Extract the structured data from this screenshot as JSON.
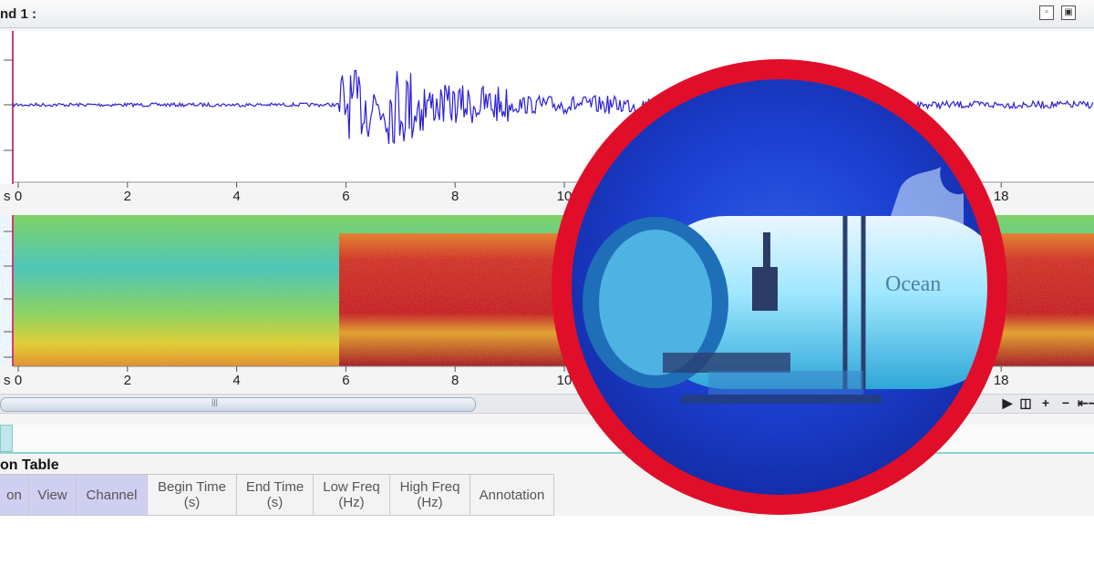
{
  "window": {
    "title": "nd 1 :",
    "restore_icon": "restore-icon",
    "maximize_icon": "maximize-icon"
  },
  "waveform": {
    "tick_labels": [
      "0",
      "2",
      "4",
      "6",
      "8",
      "10",
      "18"
    ],
    "axis_unit": "s",
    "trace_color": "#2b1fd6"
  },
  "spectrogram": {
    "tick_labels": [
      "0",
      "2",
      "4",
      "6",
      "8",
      "10",
      "18"
    ],
    "axis_unit": "s"
  },
  "controls": [
    {
      "name": "play-icon",
      "glyph": "▶"
    },
    {
      "name": "view-toggle-icon",
      "glyph": "◫"
    },
    {
      "name": "zoom-in-icon",
      "glyph": "+"
    },
    {
      "name": "zoom-out-icon",
      "glyph": "−"
    },
    {
      "name": "fit-icon",
      "glyph": "⇤⇥"
    }
  ],
  "table": {
    "title": "on Table",
    "columns": [
      {
        "line1": "on",
        "line2": "",
        "selected": true
      },
      {
        "line1": "View",
        "line2": "",
        "selected": true
      },
      {
        "line1": "Channel",
        "line2": "",
        "selected": true
      },
      {
        "line1": "Begin Time",
        "line2": "(s)",
        "selected": false
      },
      {
        "line1": "End Time",
        "line2": "(s)",
        "selected": false
      },
      {
        "line1": "Low Freq",
        "line2": "(Hz)",
        "selected": false
      },
      {
        "line1": "High Freq",
        "line2": "(Hz)",
        "selected": false
      },
      {
        "line1": "Annotation",
        "line2": "",
        "selected": false
      }
    ]
  },
  "overlay": {
    "brand_text": "Ocean",
    "ring_color": "#e10e2a"
  }
}
